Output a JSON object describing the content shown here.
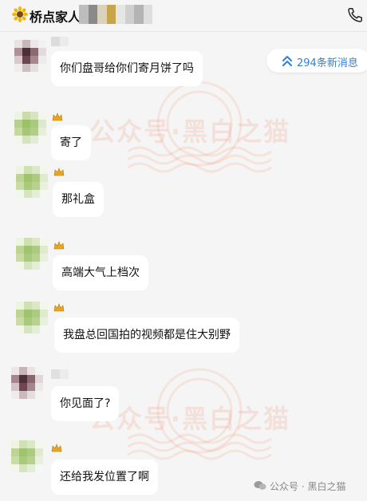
{
  "header": {
    "title": "桥点家人",
    "sun_icon": "sunflower-icon",
    "call_icon": "phone-icon"
  },
  "new_messages": {
    "label": "294条新消息",
    "icon": "double-chevron-up-icon",
    "color": "#2f7fd8"
  },
  "messages": [
    {
      "text": "你们盘哥给你们寄月饼了吗"
    },
    {
      "text": "寄了"
    },
    {
      "text": "那礼盒"
    },
    {
      "text": "高端大气上档次"
    },
    {
      "text": "我盘总回国拍的视频都是住大别野"
    },
    {
      "text": "你见面了?"
    },
    {
      "text": "还给我发位置了啊"
    }
  ],
  "watermark": {
    "stamp_text": "公众号·黑白之猫",
    "footer_text": "公众号 · 黑白之猫"
  },
  "colors": {
    "background": "#f5f5f5",
    "bubble": "#ffffff",
    "watermark": "#f57850"
  }
}
